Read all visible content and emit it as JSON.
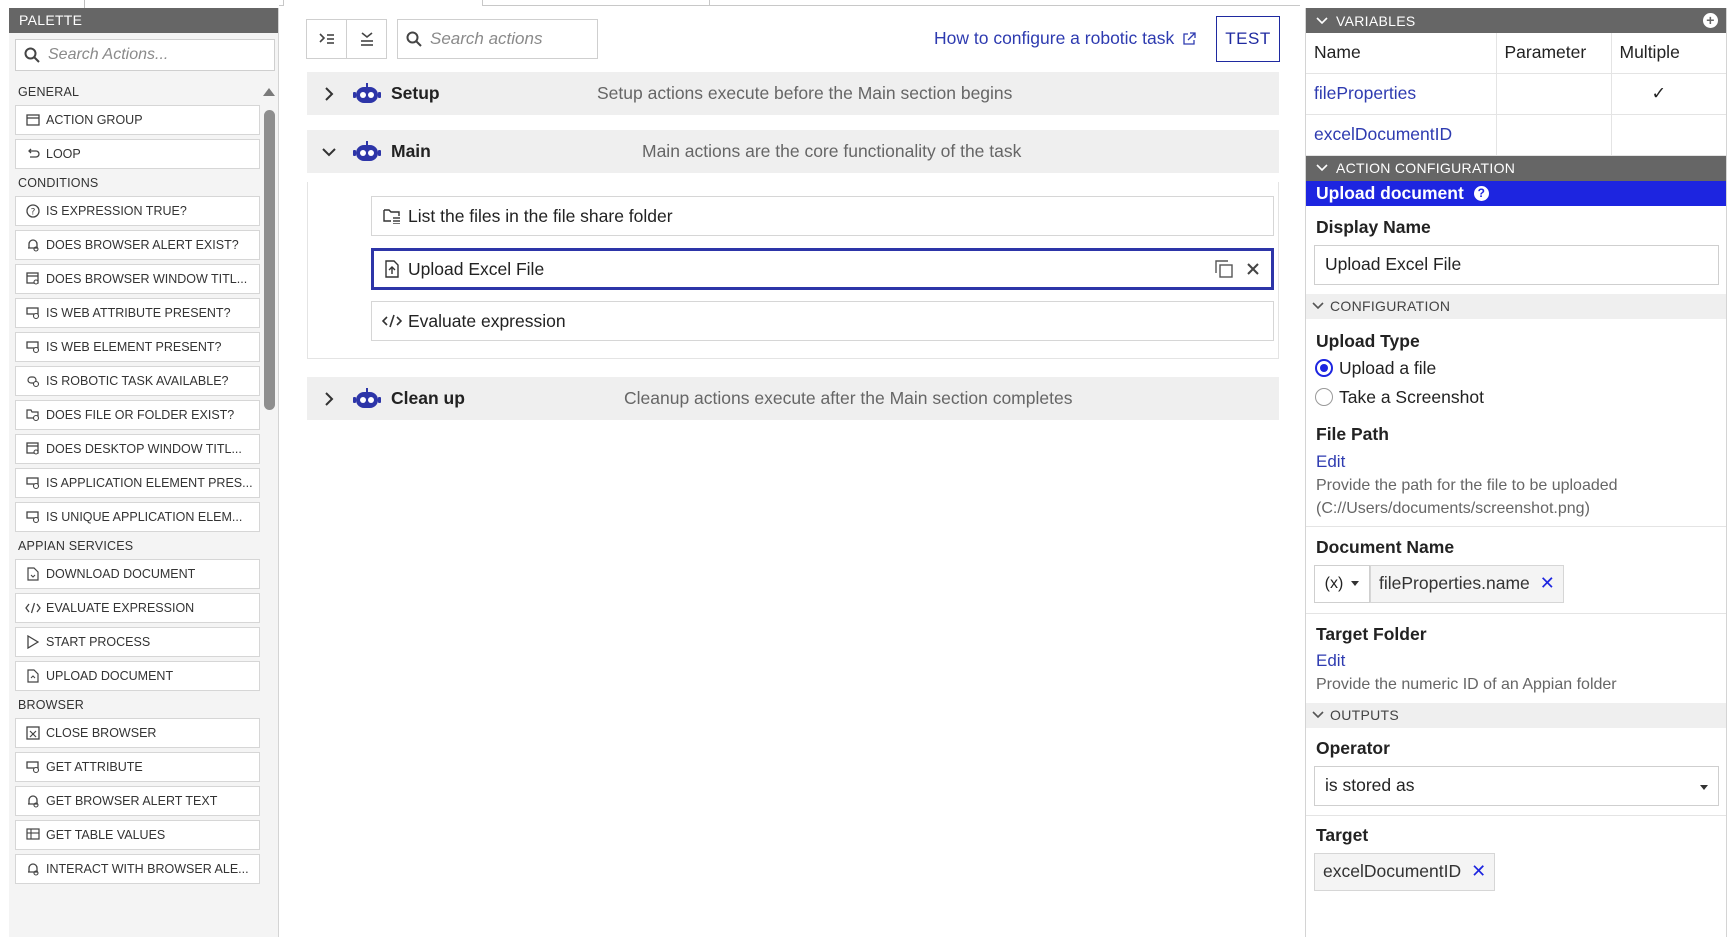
{
  "palette": {
    "title": "PALETTE",
    "search_placeholder": "Search Actions...",
    "categories": [
      {
        "label": "GENERAL",
        "items": [
          {
            "label": "ACTION GROUP",
            "icon": "action-group-icon"
          },
          {
            "label": "LOOP",
            "icon": "loop-icon"
          }
        ]
      },
      {
        "label": "CONDITIONS",
        "items": [
          {
            "label": "IS EXPRESSION TRUE?",
            "icon": "question-icon"
          },
          {
            "label": "DOES BROWSER ALERT EXIST?",
            "icon": "bell-search-icon"
          },
          {
            "label": "DOES BROWSER WINDOW TITL...",
            "icon": "window-search-icon"
          },
          {
            "label": "IS WEB ATTRIBUTE PRESENT?",
            "icon": "element-search-icon"
          },
          {
            "label": "IS WEB ELEMENT PRESENT?",
            "icon": "element-search-icon"
          },
          {
            "label": "IS ROBOTIC TASK AVAILABLE?",
            "icon": "robot-search-icon"
          },
          {
            "label": "DOES FILE OR FOLDER EXIST?",
            "icon": "folder-search-icon"
          },
          {
            "label": "DOES DESKTOP WINDOW TITL...",
            "icon": "window-search-icon"
          },
          {
            "label": "IS APPLICATION ELEMENT PRES...",
            "icon": "element-search-icon"
          },
          {
            "label": "IS UNIQUE APPLICATION ELEM...",
            "icon": "element-search-icon"
          }
        ]
      },
      {
        "label": "APPIAN SERVICES",
        "items": [
          {
            "label": "DOWNLOAD DOCUMENT",
            "icon": "document-download-icon"
          },
          {
            "label": "EVALUATE EXPRESSION",
            "icon": "code-icon"
          },
          {
            "label": "START PROCESS",
            "icon": "play-icon"
          },
          {
            "label": "UPLOAD DOCUMENT",
            "icon": "document-upload-icon"
          }
        ]
      },
      {
        "label": "BROWSER",
        "items": [
          {
            "label": "CLOSE BROWSER",
            "icon": "close-window-icon"
          },
          {
            "label": "GET ATTRIBUTE",
            "icon": "element-search-icon"
          },
          {
            "label": "GET BROWSER ALERT TEXT",
            "icon": "bell-search-icon"
          },
          {
            "label": "GET TABLE VALUES",
            "icon": "table-icon"
          },
          {
            "label": "INTERACT WITH BROWSER ALE...",
            "icon": "bell-search-icon"
          }
        ]
      }
    ]
  },
  "toolbar": {
    "search_placeholder": "Search actions",
    "howto_link": "How to configure a robotic task",
    "test_label": "TEST"
  },
  "sections": {
    "setup": {
      "title": "Setup",
      "desc": "Setup actions execute before the Main section begins"
    },
    "main": {
      "title": "Main",
      "desc": "Main actions are the core functionality of the task"
    },
    "cleanup": {
      "title": "Clean up",
      "desc": "Cleanup actions execute after the Main section completes"
    }
  },
  "main_steps": [
    {
      "label": "List the files in the file share folder",
      "icon": "folder-list-icon"
    },
    {
      "label": "Upload Excel File",
      "icon": "document-upload-icon"
    },
    {
      "label": "Evaluate expression",
      "icon": "code-icon"
    }
  ],
  "variables": {
    "title": "VARIABLES",
    "columns": [
      "Name",
      "Parameter",
      "Multiple"
    ],
    "rows": [
      {
        "name": "fileProperties",
        "parameter": "",
        "multiple": "✓"
      },
      {
        "name": "excelDocumentID",
        "parameter": "",
        "multiple": ""
      }
    ]
  },
  "action_config": {
    "title": "ACTION CONFIGURATION",
    "action_name": "Upload document",
    "display_name_label": "Display Name",
    "display_name_value": "Upload Excel File",
    "configuration_title": "CONFIGURATION",
    "upload_type_label": "Upload Type",
    "upload_options": [
      "Upload a file",
      "Take a Screenshot"
    ],
    "file_path_label": "File Path",
    "edit_label": "Edit",
    "file_path_help_1": "Provide the path for the file to be uploaded",
    "file_path_help_2": "(C://Users/documents/screenshot.png)",
    "document_name_label": "Document Name",
    "expr_toggle": "(x)",
    "document_name_chip": "fileProperties.name",
    "target_folder_label": "Target Folder",
    "target_folder_help": "Provide the numeric ID of an Appian folder",
    "outputs_title": "OUTPUTS",
    "operator_label": "Operator",
    "operator_value": "is stored as",
    "target_label": "Target",
    "target_chip": "excelDocumentID"
  }
}
